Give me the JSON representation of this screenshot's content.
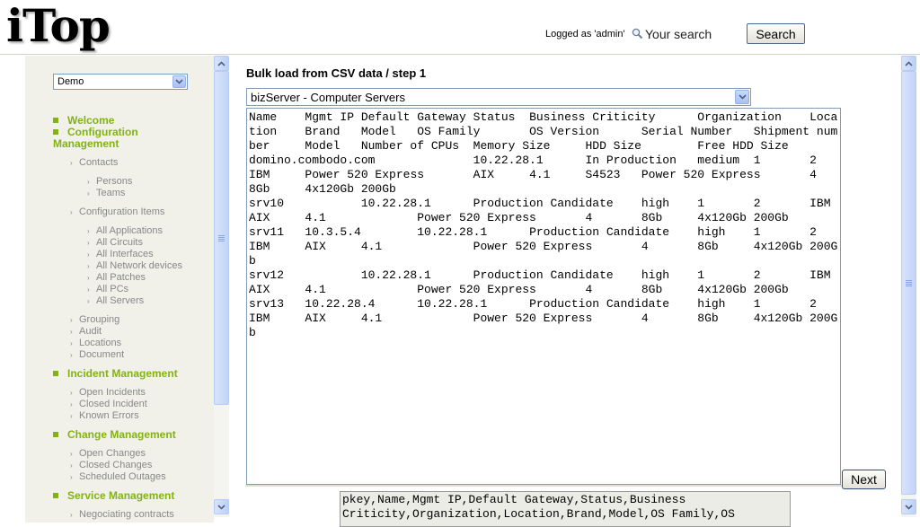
{
  "header": {
    "logo": "iTop",
    "logged_as": "Logged as 'admin'",
    "search_placeholder": "Your search",
    "search_button": "Search"
  },
  "sidebar": {
    "org_select": "Demo",
    "welcome": "Welcome",
    "configuration": "Configuration Management",
    "contacts": "Contacts",
    "persons": "Persons",
    "teams": "Teams",
    "config_items": "Configuration Items",
    "all_applications": "All Applications",
    "all_circuits": "All Circuits",
    "all_interfaces": "All Interfaces",
    "all_network_devices": "All Network devices",
    "all_patches": "All Patches",
    "all_pcs": "All PCs",
    "all_servers": "All Servers",
    "grouping": "Grouping",
    "audit": "Audit",
    "locations": "Locations",
    "document": "Document",
    "incident": "Incident Management",
    "open_incidents": "Open Incidents",
    "closed_incident": "Closed Incident",
    "known_errors": "Known Errors",
    "change": "Change Management",
    "open_changes": "Open Changes",
    "closed_changes": "Closed Changes",
    "scheduled_outages": "Scheduled Outages",
    "service": "Service Management",
    "negotiating": "Negociating contracts"
  },
  "main": {
    "title": "Bulk load from CSV data / step 1",
    "class_select": "bizServer - Computer Servers",
    "csv_text": "Name\tMgmt IP\tDefault Gateway\tStatus\tBusiness Criticity\tOrganization\tLocation\tBrand\tModel\tOS Family\tOS Version\tSerial Number\tShipment number\tModel\tNumber of CPUs\tMemory Size\tHDD Size\tFree HDD Size\ndomino.combodo.com\t\t10.22.28.1\tIn Production\tmedium\t1\t2\tIBM\tPower 520 Express\tAIX\t4.1\tS4523\tPower 520 Express\t4\t8Gb\t4x120Gb 200Gb\nsrv10\t\t10.22.28.1\tProduction Candidate\thigh\t1\t2\tIBM\tAIX\t4.1\t\tPower 520 Express\t4\t8Gb\t4x120Gb 200Gb\nsrv11\t10.3.5.4\t10.22.28.1\tProduction Candidate\thigh\t1\t2\tIBM\tAIX\t4.1\t\tPower 520 Express\t4\t8Gb\t4x120Gb 200Gb\nsrv12\t\t10.22.28.1\tProduction Candidate\thigh\t1\t2\tIBM\tAIX\t4.1\t\tPower 520 Express\t4\t8Gb\t4x120Gb 200Gb\nsrv13\t10.22.28.4\t10.22.28.1\tProduction Candidate\thigh\t1\t2\tIBM\tAIX\t4.1\t\tPower 520 Express\t4\t8Gb\t4x120Gb 200Gb",
    "next_button": "Next",
    "preview_text": "pkey,Name,Mgmt IP,Default Gateway,Status,Business\nCriticity,Organization,Location,Brand,Model,OS Family,OS"
  },
  "colors": {
    "accent_green": "#83b217",
    "sidebar_bg": "#f1f1ea"
  }
}
